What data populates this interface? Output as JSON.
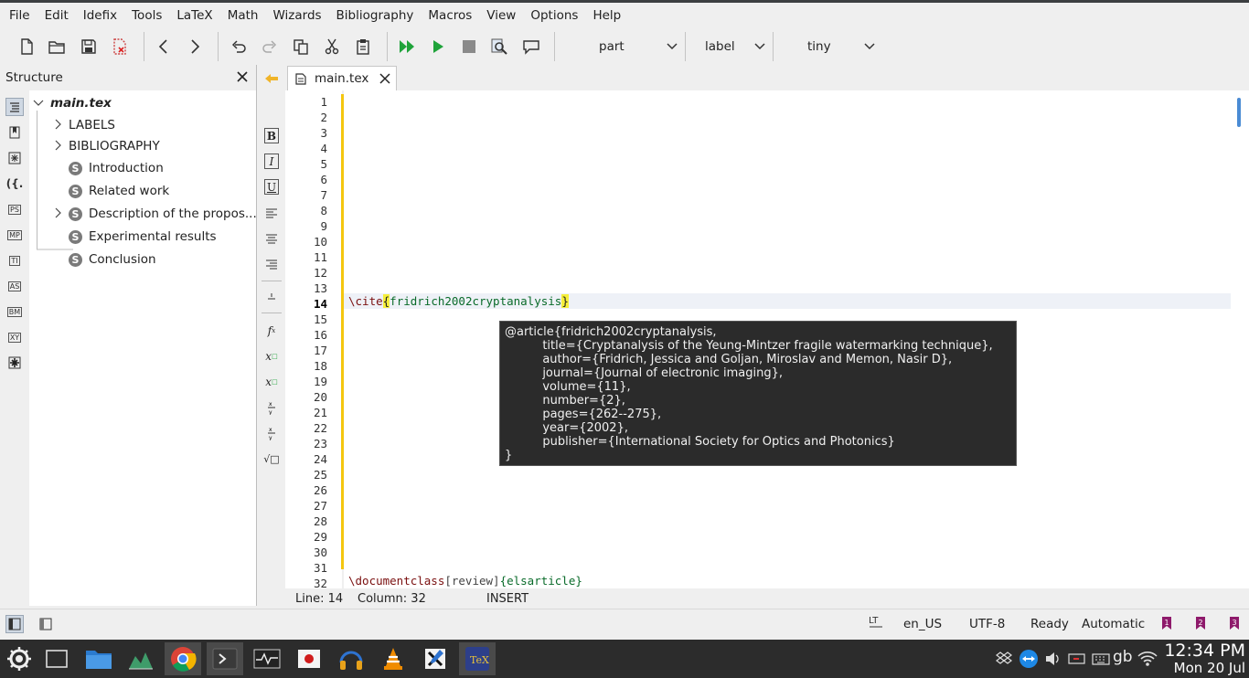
{
  "menu": [
    "File",
    "Edit",
    "Idefix",
    "Tools",
    "LaTeX",
    "Math",
    "Wizards",
    "Bibliography",
    "Macros",
    "View",
    "Options",
    "Help"
  ],
  "toolbar": {
    "combo_part": "part",
    "combo_label": "label",
    "combo_size": "tiny"
  },
  "structure": {
    "title": "Structure",
    "root": "main.tex",
    "items": [
      "LABELS",
      "BIBLIOGRAPHY",
      "Introduction",
      "Related work",
      "Description of the propos...",
      "Experimental results",
      "Conclusion"
    ]
  },
  "vtabs": [
    "PS",
    "MP",
    "TI",
    "AS",
    "BM",
    "XY"
  ],
  "editor": {
    "tab_label": "main.tex",
    "line_numbers": [
      "1",
      "2",
      "3",
      "4",
      "5",
      "6",
      "7",
      "8",
      "9",
      "10",
      "11",
      "12",
      "13",
      "14",
      "15",
      "16",
      "17",
      "18",
      "19",
      "20",
      "21",
      "22",
      "23",
      "24",
      "25",
      "26",
      "27",
      "28",
      "29",
      "30",
      "31",
      "32"
    ],
    "current_line": "14",
    "line14_cmd": "\\cite",
    "line14_open": "{",
    "line14_arg": "fridrich2002cryptanalysis",
    "line14_close": "}",
    "line32_cmd": "\\documentclass",
    "line32_opt": "[review]",
    "line32_arg": "{elsarticle}"
  },
  "tooltip": {
    "text": "@article{fridrich2002cryptanalysis,\n          title={Cryptanalysis of the Yeung-Mintzer fragile watermarking technique},\n          author={Fridrich, Jessica and Goljan, Miroslav and Memon, Nasir D},\n          journal={Journal of electronic imaging},\n          volume={11},\n          number={2},\n          pages={262--275},\n          year={2002},\n          publisher={International Society for Optics and Photonics}\n}"
  },
  "editstatus": {
    "line": "Line: 14",
    "column": "Column: 32",
    "mode": "INSERT"
  },
  "statusbar": {
    "language": "en_US",
    "encoding": "UTF-8",
    "state": "Ready",
    "mode": "Automatic",
    "bookmark1": "1",
    "bookmark2": "2",
    "bookmark3": "3"
  },
  "taskbar": {
    "lang": "gb",
    "time": "12:34 PM",
    "date": "Mon 20 Jul"
  },
  "colors": {
    "accent": "#4a8bd4",
    "run_green": "#1fa33a",
    "bookmark": "#8e1a6b",
    "gutter_mark": "#f4c60f"
  }
}
